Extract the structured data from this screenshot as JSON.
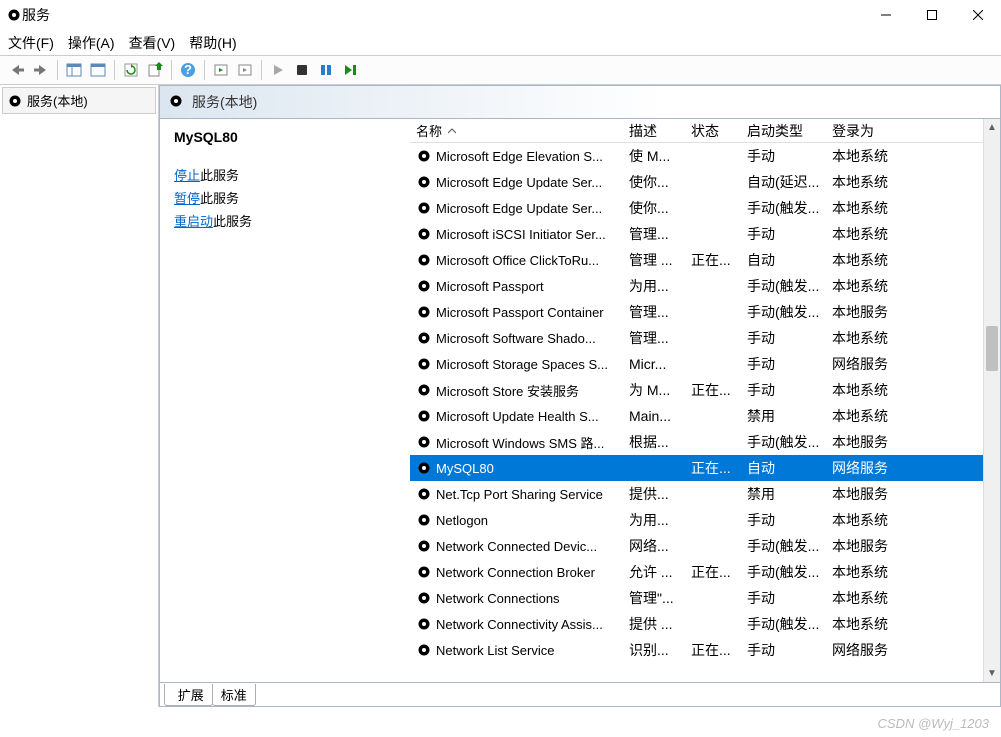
{
  "window": {
    "title": "服务"
  },
  "menu": [
    "文件(F)",
    "操作(A)",
    "查看(V)",
    "帮助(H)"
  ],
  "sidebar": {
    "item": "服务(本地)"
  },
  "contentHeader": "服务(本地)",
  "details": {
    "name": "MySQL80",
    "actions": [
      {
        "link": "停止",
        "suffix": "此服务"
      },
      {
        "link": "暂停",
        "suffix": "此服务"
      },
      {
        "link": "重启动",
        "suffix": "此服务"
      }
    ]
  },
  "columns": {
    "name": "名称",
    "desc": "描述",
    "status": "状态",
    "startup": "启动类型",
    "logon": "登录为"
  },
  "rows": [
    {
      "name": "Microsoft Edge Elevation S...",
      "desc": "使 M...",
      "status": "",
      "startup": "手动",
      "logon": "本地系统"
    },
    {
      "name": "Microsoft Edge Update Ser...",
      "desc": "使你...",
      "status": "",
      "startup": "自动(延迟...",
      "logon": "本地系统"
    },
    {
      "name": "Microsoft Edge Update Ser...",
      "desc": "使你...",
      "status": "",
      "startup": "手动(触发...",
      "logon": "本地系统"
    },
    {
      "name": "Microsoft iSCSI Initiator Ser...",
      "desc": "管理...",
      "status": "",
      "startup": "手动",
      "logon": "本地系统"
    },
    {
      "name": "Microsoft Office ClickToRu...",
      "desc": "管理 ...",
      "status": "正在...",
      "startup": "自动",
      "logon": "本地系统"
    },
    {
      "name": "Microsoft Passport",
      "desc": "为用...",
      "status": "",
      "startup": "手动(触发...",
      "logon": "本地系统"
    },
    {
      "name": "Microsoft Passport Container",
      "desc": "管理...",
      "status": "",
      "startup": "手动(触发...",
      "logon": "本地服务"
    },
    {
      "name": "Microsoft Software Shado...",
      "desc": "管理...",
      "status": "",
      "startup": "手动",
      "logon": "本地系统"
    },
    {
      "name": "Microsoft Storage Spaces S...",
      "desc": "Micr...",
      "status": "",
      "startup": "手动",
      "logon": "网络服务"
    },
    {
      "name": "Microsoft Store 安装服务",
      "desc": "为 M...",
      "status": "正在...",
      "startup": "手动",
      "logon": "本地系统"
    },
    {
      "name": "Microsoft Update Health S...",
      "desc": "Main...",
      "status": "",
      "startup": "禁用",
      "logon": "本地系统"
    },
    {
      "name": "Microsoft Windows SMS 路...",
      "desc": "根据...",
      "status": "",
      "startup": "手动(触发...",
      "logon": "本地服务"
    },
    {
      "name": "MySQL80",
      "desc": "",
      "status": "正在...",
      "startup": "自动",
      "logon": "网络服务",
      "selected": true
    },
    {
      "name": "Net.Tcp Port Sharing Service",
      "desc": "提供...",
      "status": "",
      "startup": "禁用",
      "logon": "本地服务"
    },
    {
      "name": "Netlogon",
      "desc": "为用...",
      "status": "",
      "startup": "手动",
      "logon": "本地系统"
    },
    {
      "name": "Network Connected Devic...",
      "desc": "网络...",
      "status": "",
      "startup": "手动(触发...",
      "logon": "本地服务"
    },
    {
      "name": "Network Connection Broker",
      "desc": "允许 ...",
      "status": "正在...",
      "startup": "手动(触发...",
      "logon": "本地系统"
    },
    {
      "name": "Network Connections",
      "desc": "管理\"...",
      "status": "",
      "startup": "手动",
      "logon": "本地系统"
    },
    {
      "name": "Network Connectivity Assis...",
      "desc": "提供 ...",
      "status": "",
      "startup": "手动(触发...",
      "logon": "本地系统"
    },
    {
      "name": "Network List Service",
      "desc": "识别...",
      "status": "正在...",
      "startup": "手动",
      "logon": "网络服务"
    }
  ],
  "tabs": {
    "extended": "扩展",
    "standard": "标准"
  },
  "footer": "CSDN @Wyj_1203"
}
